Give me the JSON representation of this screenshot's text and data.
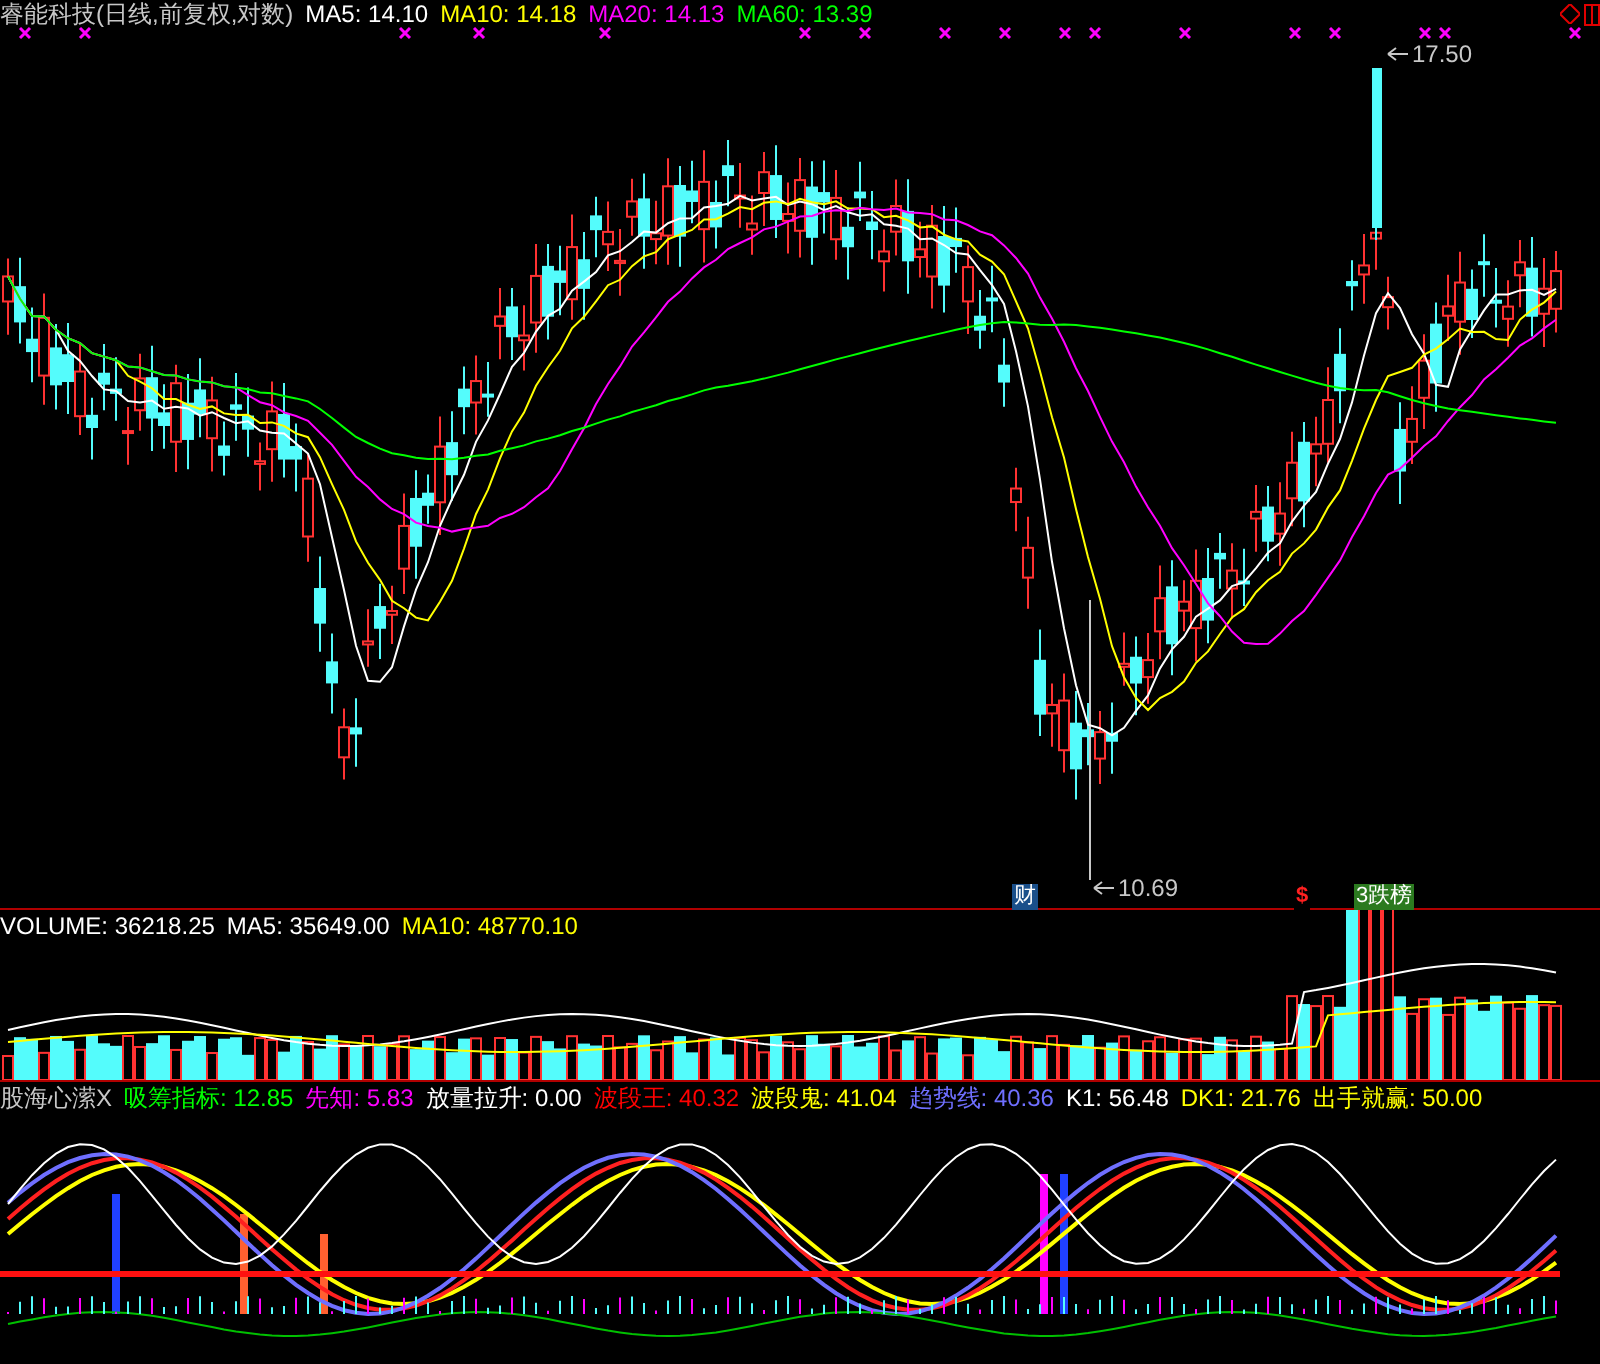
{
  "main_chart": {
    "title": "睿能科技(日线,前复权,对数)",
    "readings": [
      {
        "label": "MA5:",
        "value": "14.10",
        "color": "#ffffff"
      },
      {
        "label": "MA10:",
        "value": "14.18",
        "color": "#ffff00"
      },
      {
        "label": "MA20:",
        "value": "14.13",
        "color": "#ff00ff"
      },
      {
        "label": "MA60:",
        "value": "13.39",
        "color": "#00ff00"
      }
    ],
    "high_marker": "17.50",
    "low_marker": "10.69",
    "badges": [
      {
        "text": "财",
        "color": "#1a4f8a"
      },
      {
        "text": "$",
        "color": "#000000"
      },
      {
        "text": "3跌榜",
        "color": "#2b7a1f"
      }
    ]
  },
  "volume_panel": {
    "readings": [
      {
        "label": "VOLUME:",
        "value": "36218.25",
        "color": "#ffffff"
      },
      {
        "label": "MA5:",
        "value": "35649.00",
        "color": "#ffffff"
      },
      {
        "label": "MA10:",
        "value": "48770.10",
        "color": "#ffff00"
      }
    ]
  },
  "indicator_panel": {
    "title": "股海心潆X",
    "readings": [
      {
        "label": "吸筹指标:",
        "value": "12.85",
        "color": "#00ff00"
      },
      {
        "label": "先知:",
        "value": "5.83",
        "color": "#ff00ff"
      },
      {
        "label": "放量拉升:",
        "value": "0.00",
        "color": "#ffffff"
      },
      {
        "label": "波段王:",
        "value": "40.32",
        "color": "#ff0000"
      },
      {
        "label": "波段鬼:",
        "value": "41.04",
        "color": "#ffff00"
      },
      {
        "label": "趋势线:",
        "value": "40.36",
        "color": "#6f6fff"
      },
      {
        "label": "K1:",
        "value": "56.48",
        "color": "#ffffff"
      },
      {
        "label": "DK1:",
        "value": "21.76",
        "color": "#ffff00"
      },
      {
        "label": "出手就赢:",
        "value": "50.00",
        "color": "#ffff00"
      }
    ]
  }
}
